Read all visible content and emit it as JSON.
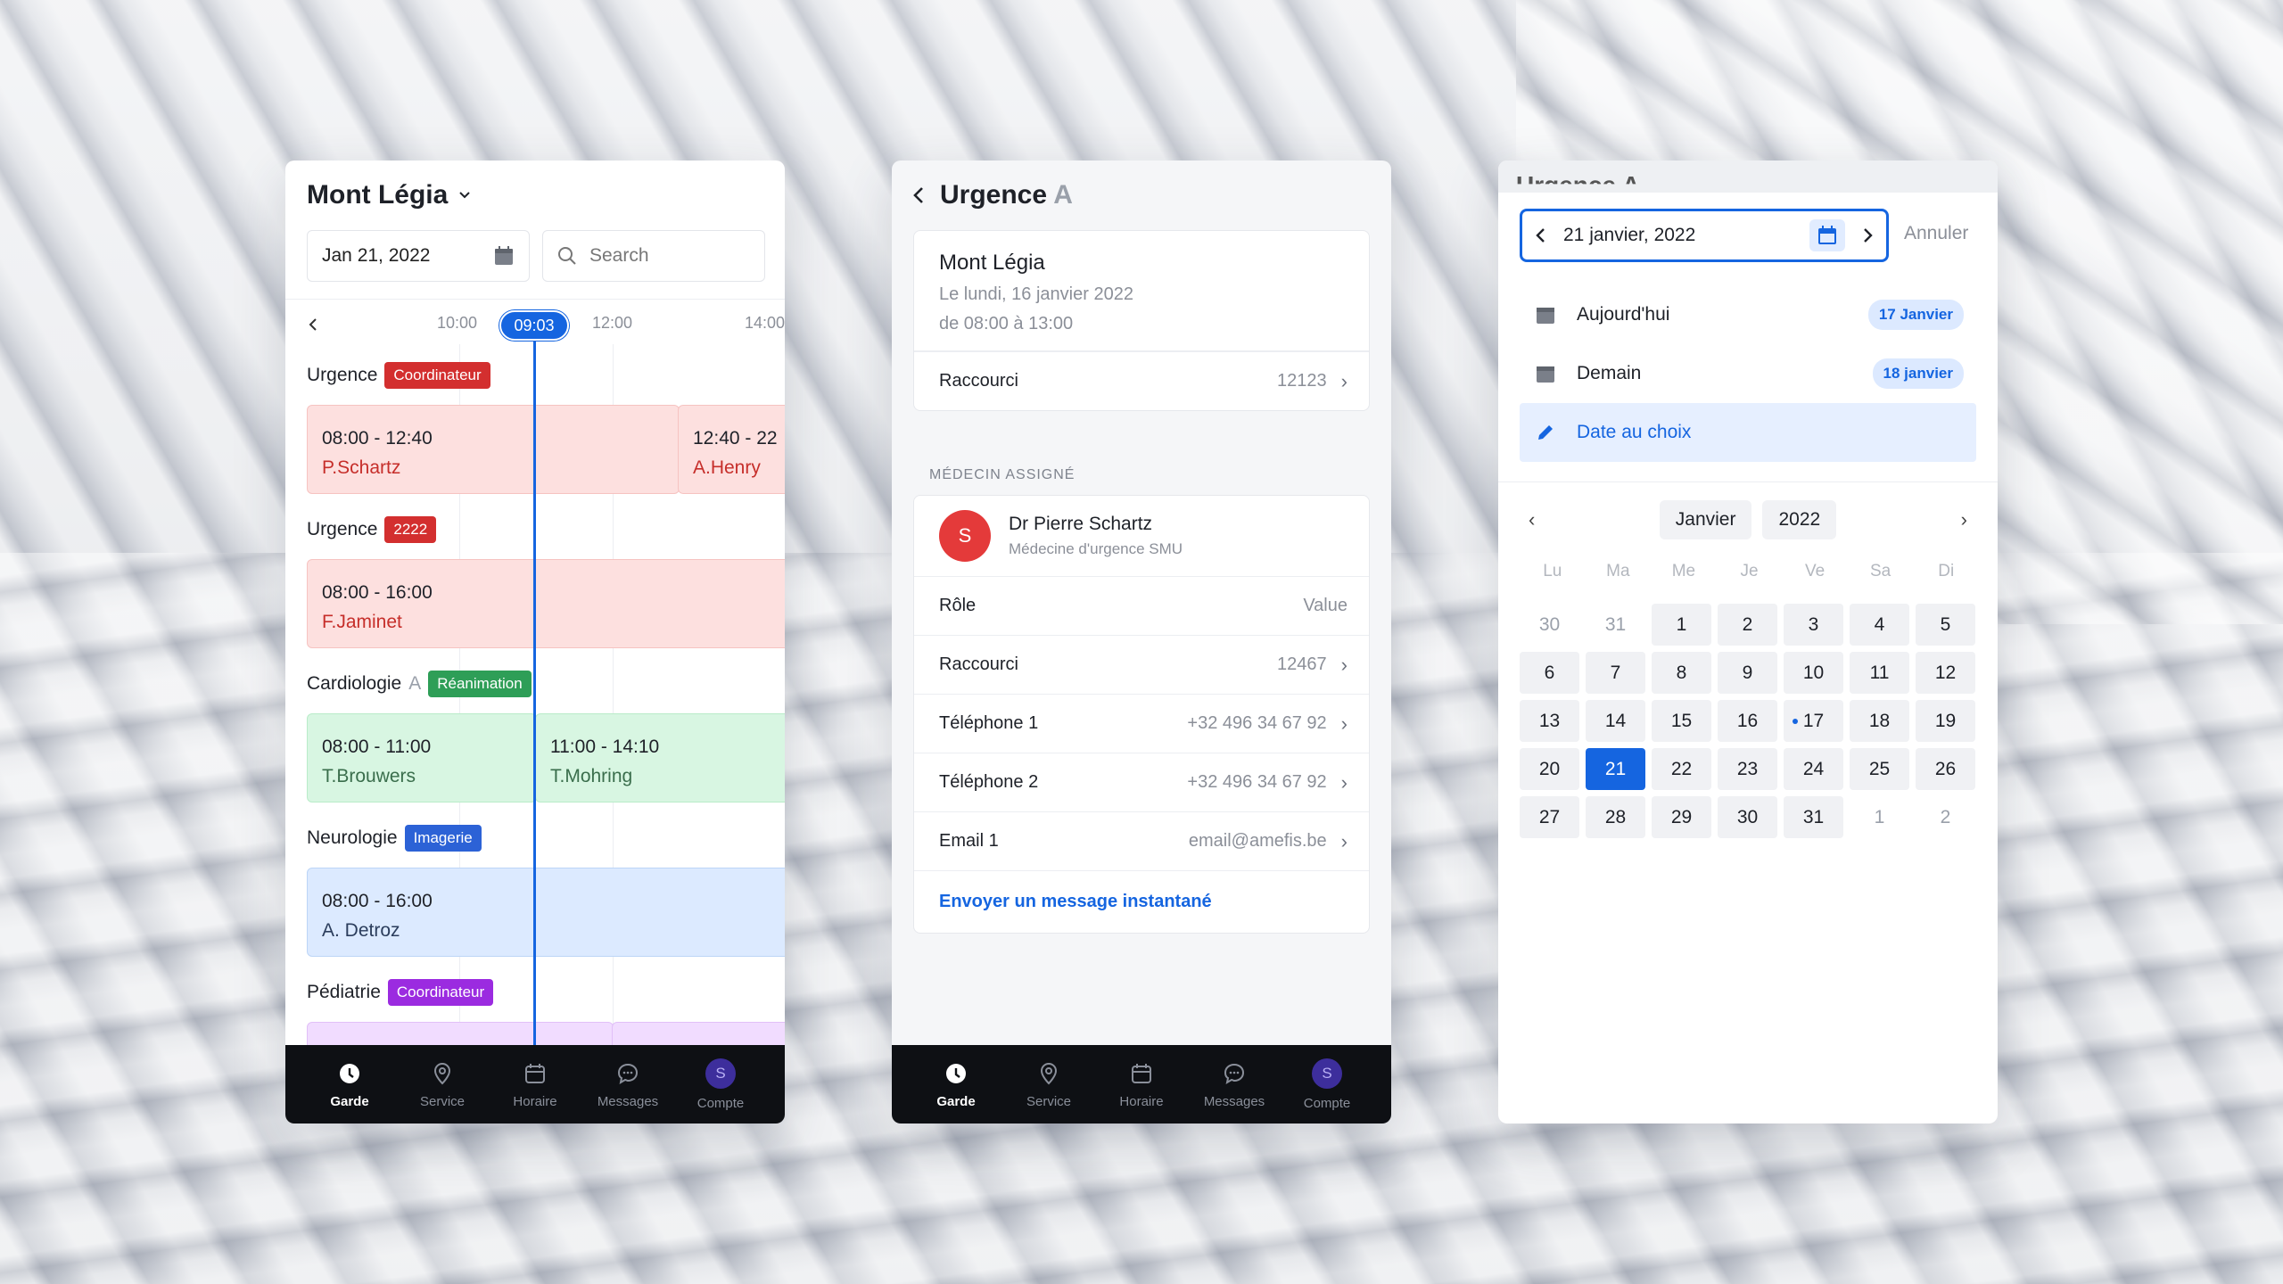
{
  "tabs": [
    {
      "label": "Garde",
      "icon": "clock-icon",
      "active": true
    },
    {
      "label": "Service",
      "icon": "map-pin-icon",
      "active": false
    },
    {
      "label": "Horaire",
      "icon": "calendar-icon",
      "active": false
    },
    {
      "label": "Messages",
      "icon": "chat-icon",
      "active": false
    },
    {
      "label": "Compte",
      "icon": "avatar",
      "initial": "S",
      "active": false
    }
  ],
  "screen1": {
    "title": "Mont Légia",
    "date_value": "Jan 21, 2022",
    "search_placeholder": "Search",
    "ticks": [
      "10:00",
      "12:00",
      "14:00"
    ],
    "now": "09:03",
    "sections": [
      {
        "name": "Urgence",
        "muted": "",
        "badge": "Coordinateur",
        "badge_color": "#d32f2f"
      },
      {
        "name": "Urgence",
        "muted": "",
        "badge": "2222",
        "badge_color": "#d32f2f"
      },
      {
        "name": "Cardiologie",
        "muted": "A",
        "badge": "Réanimation",
        "badge_color": "#2e9e57"
      },
      {
        "name": "Neurologie",
        "muted": "",
        "badge": "Imagerie",
        "badge_color": "#2c62d6"
      },
      {
        "name": "Pédiatrie",
        "muted": "",
        "badge": "Coordinateur",
        "badge_color": "#9b2be0"
      }
    ],
    "shifts": [
      {
        "time": "08:00 - 12:40",
        "who": "P.Schartz"
      },
      {
        "time": "12:40 - 22",
        "who": "A.Henry"
      },
      {
        "time": "08:00 - 16:00",
        "who": "F.Jaminet"
      },
      {
        "time": "08:00 - 11:00",
        "who": "T.Brouwers"
      },
      {
        "time": "11:00 - 14:10",
        "who": "T.Mohring"
      },
      {
        "time": "08:00 - 16:00",
        "who": "A. Detroz"
      }
    ]
  },
  "screen2": {
    "title": "Urgence",
    "title_muted": "A",
    "place": "Mont Légia",
    "date_line": "Le lundi, 16 janvier 2022",
    "time_line": "de 08:00 à 13:00",
    "shortcut_label": "Raccourci",
    "shortcut_value": "12123",
    "section_caption": "MÉDECIN ASSIGNÉ",
    "doctor_initial": "S",
    "doctor_name": "Dr Pierre Schartz",
    "doctor_role": "Médecine d'urgence SMU",
    "rows": [
      {
        "label": "Rôle",
        "value": "Value"
      },
      {
        "label": "Raccourci",
        "value": "12467"
      },
      {
        "label": "Téléphone 1",
        "value": "+32 496 34 67 92"
      },
      {
        "label": "Téléphone 2",
        "value": "+32 496 34 67 92"
      },
      {
        "label": "Email 1",
        "value": "email@amefis.be"
      }
    ],
    "message_link": "Envoyer un message instantané"
  },
  "screen3": {
    "peek_title": "Urgence A",
    "date_value": "21 janvier, 2022",
    "cancel": "Annuler",
    "quick": [
      {
        "label": "Aujourd'hui",
        "pill": "17 Janvier"
      },
      {
        "label": "Demain",
        "pill": "18 janvier"
      },
      {
        "label": "Date au choix",
        "pill": ""
      }
    ],
    "month": "Janvier",
    "year": "2022",
    "weekdays": [
      "Lu",
      "Ma",
      "Me",
      "Je",
      "Ve",
      "Sa",
      "Di"
    ],
    "days": [
      {
        "d": "30",
        "out": true
      },
      {
        "d": "31",
        "out": true
      },
      {
        "d": "1"
      },
      {
        "d": "2"
      },
      {
        "d": "3"
      },
      {
        "d": "4"
      },
      {
        "d": "5"
      },
      {
        "d": "6"
      },
      {
        "d": "7"
      },
      {
        "d": "8"
      },
      {
        "d": "9"
      },
      {
        "d": "10"
      },
      {
        "d": "11"
      },
      {
        "d": "12"
      },
      {
        "d": "13"
      },
      {
        "d": "14"
      },
      {
        "d": "15"
      },
      {
        "d": "16"
      },
      {
        "d": "17",
        "dot": true
      },
      {
        "d": "18"
      },
      {
        "d": "19"
      },
      {
        "d": "20"
      },
      {
        "d": "21",
        "selected": true
      },
      {
        "d": "22"
      },
      {
        "d": "23"
      },
      {
        "d": "24"
      },
      {
        "d": "25"
      },
      {
        "d": "26"
      },
      {
        "d": "27"
      },
      {
        "d": "28"
      },
      {
        "d": "29"
      },
      {
        "d": "30"
      },
      {
        "d": "31"
      },
      {
        "d": "1",
        "out": true
      },
      {
        "d": "2",
        "out": true
      }
    ]
  }
}
